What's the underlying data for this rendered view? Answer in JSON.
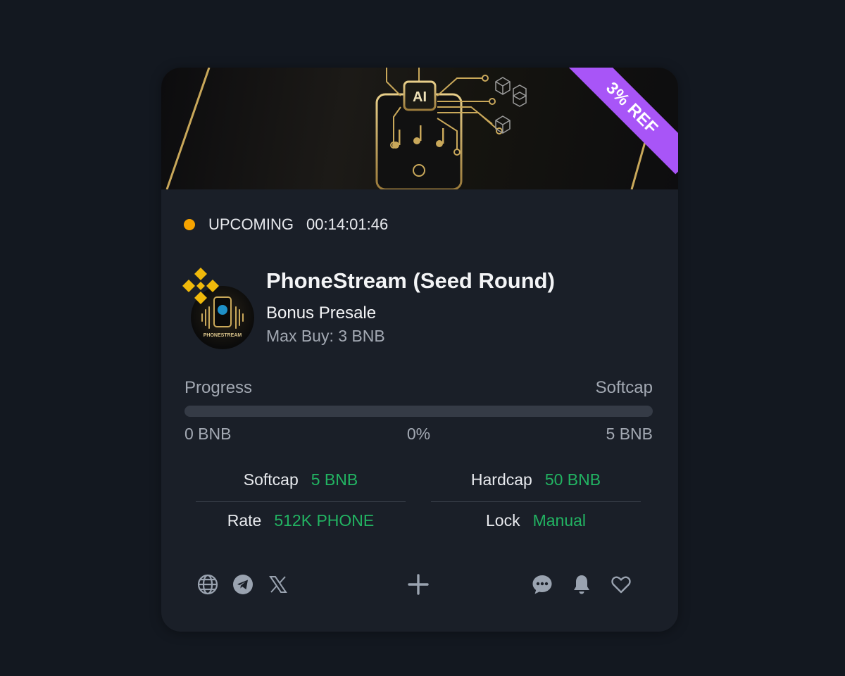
{
  "banner": {
    "ribbon_label": "3% REF",
    "ribbon_color": "#a855f7",
    "image_icon": "ai-phone-music-art",
    "chip_text": "AI"
  },
  "status": {
    "label": "UPCOMING",
    "timer": "00:14:01:46",
    "dot_color": "#f6a300"
  },
  "project": {
    "name": "PhoneStream (Seed Round)",
    "subtitle": "Bonus Presale",
    "max_buy": "Max Buy: 3 BNB",
    "chain_icon": "bnb-chain-icon",
    "avatar_caption": "PHONESTREAM"
  },
  "progress": {
    "label": "Progress",
    "cap_label": "Softcap",
    "raised": "0 BNB",
    "percent": "0%",
    "fill_fraction": 0,
    "target": "5 BNB"
  },
  "stats": {
    "softcap": {
      "label": "Softcap",
      "value": "5 BNB"
    },
    "hardcap": {
      "label": "Hardcap",
      "value": "50 BNB"
    },
    "rate": {
      "label": "Rate",
      "value": "512K PHONE"
    },
    "lock": {
      "label": "Lock",
      "value": "Manual"
    }
  },
  "colors": {
    "background": "#131820",
    "card": "#1a1f28",
    "accent_green": "#22b362",
    "muted_text": "#a3a9b3"
  },
  "footer": {
    "links": [
      "globe-icon",
      "telegram-icon",
      "x-icon"
    ],
    "center": "plus-icon",
    "actions": [
      "chat-icon",
      "bell-icon",
      "heart-icon"
    ]
  }
}
